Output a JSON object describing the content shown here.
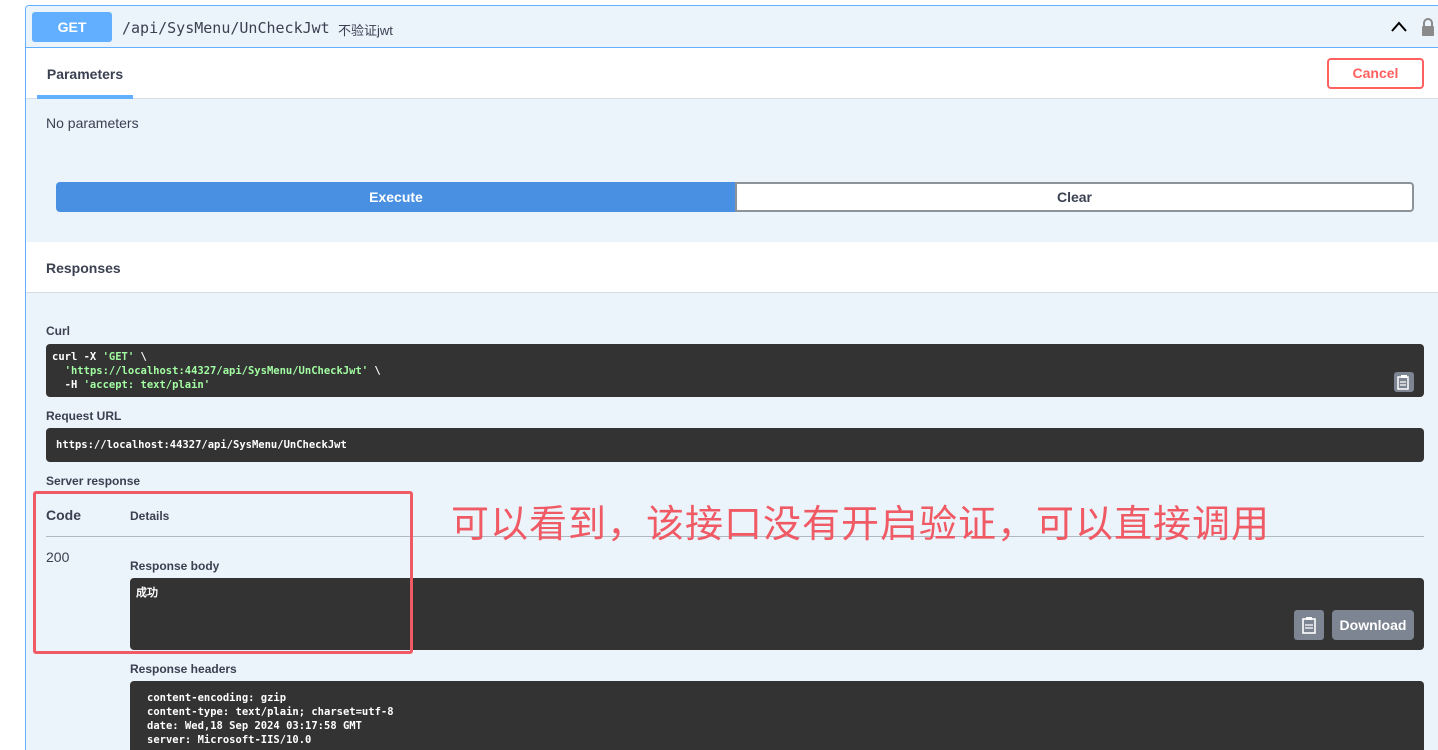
{
  "operation": {
    "method": "GET",
    "path": "/api/SysMenu/UnCheckJwt",
    "description": "不验证jwt"
  },
  "parameters": {
    "tab_label": "Parameters",
    "cancel_label": "Cancel",
    "empty_text": "No parameters"
  },
  "actions": {
    "execute_label": "Execute",
    "clear_label": "Clear"
  },
  "responses": {
    "title": "Responses",
    "curl_label": "Curl",
    "curl": {
      "line1_cmd": "curl -X ",
      "line1_method": "'GET'",
      "line1_tail": " \\",
      "line2_url": "'https://localhost:44327/api/SysMenu/UnCheckJwt'",
      "line2_tail": " \\",
      "line3_flag": "  -H ",
      "line3_header": "'accept: text/plain'"
    },
    "request_url_label": "Request URL",
    "request_url": "https://localhost:44327/api/SysMenu/UnCheckJwt",
    "server_response_label": "Server response",
    "code_header": "Code",
    "details_header": "Details",
    "status_code": "200",
    "response_body_label": "Response body",
    "response_body": "成功",
    "download_label": "Download",
    "response_headers_label": "Response headers",
    "response_headers": [
      "content-encoding: gzip",
      "content-type: text/plain; charset=utf-8",
      "date: Wed,18 Sep 2024 03:17:58 GMT",
      "server: Microsoft-IIS/10.0"
    ]
  },
  "annotation": {
    "text": "可以看到，该接口没有开启验证，可以直接调用",
    "color": "#f05a64"
  },
  "colors": {
    "get_method": "#61affe",
    "execute": "#4990e2",
    "cancel": "#ff6060",
    "code_bg": "#333333"
  }
}
